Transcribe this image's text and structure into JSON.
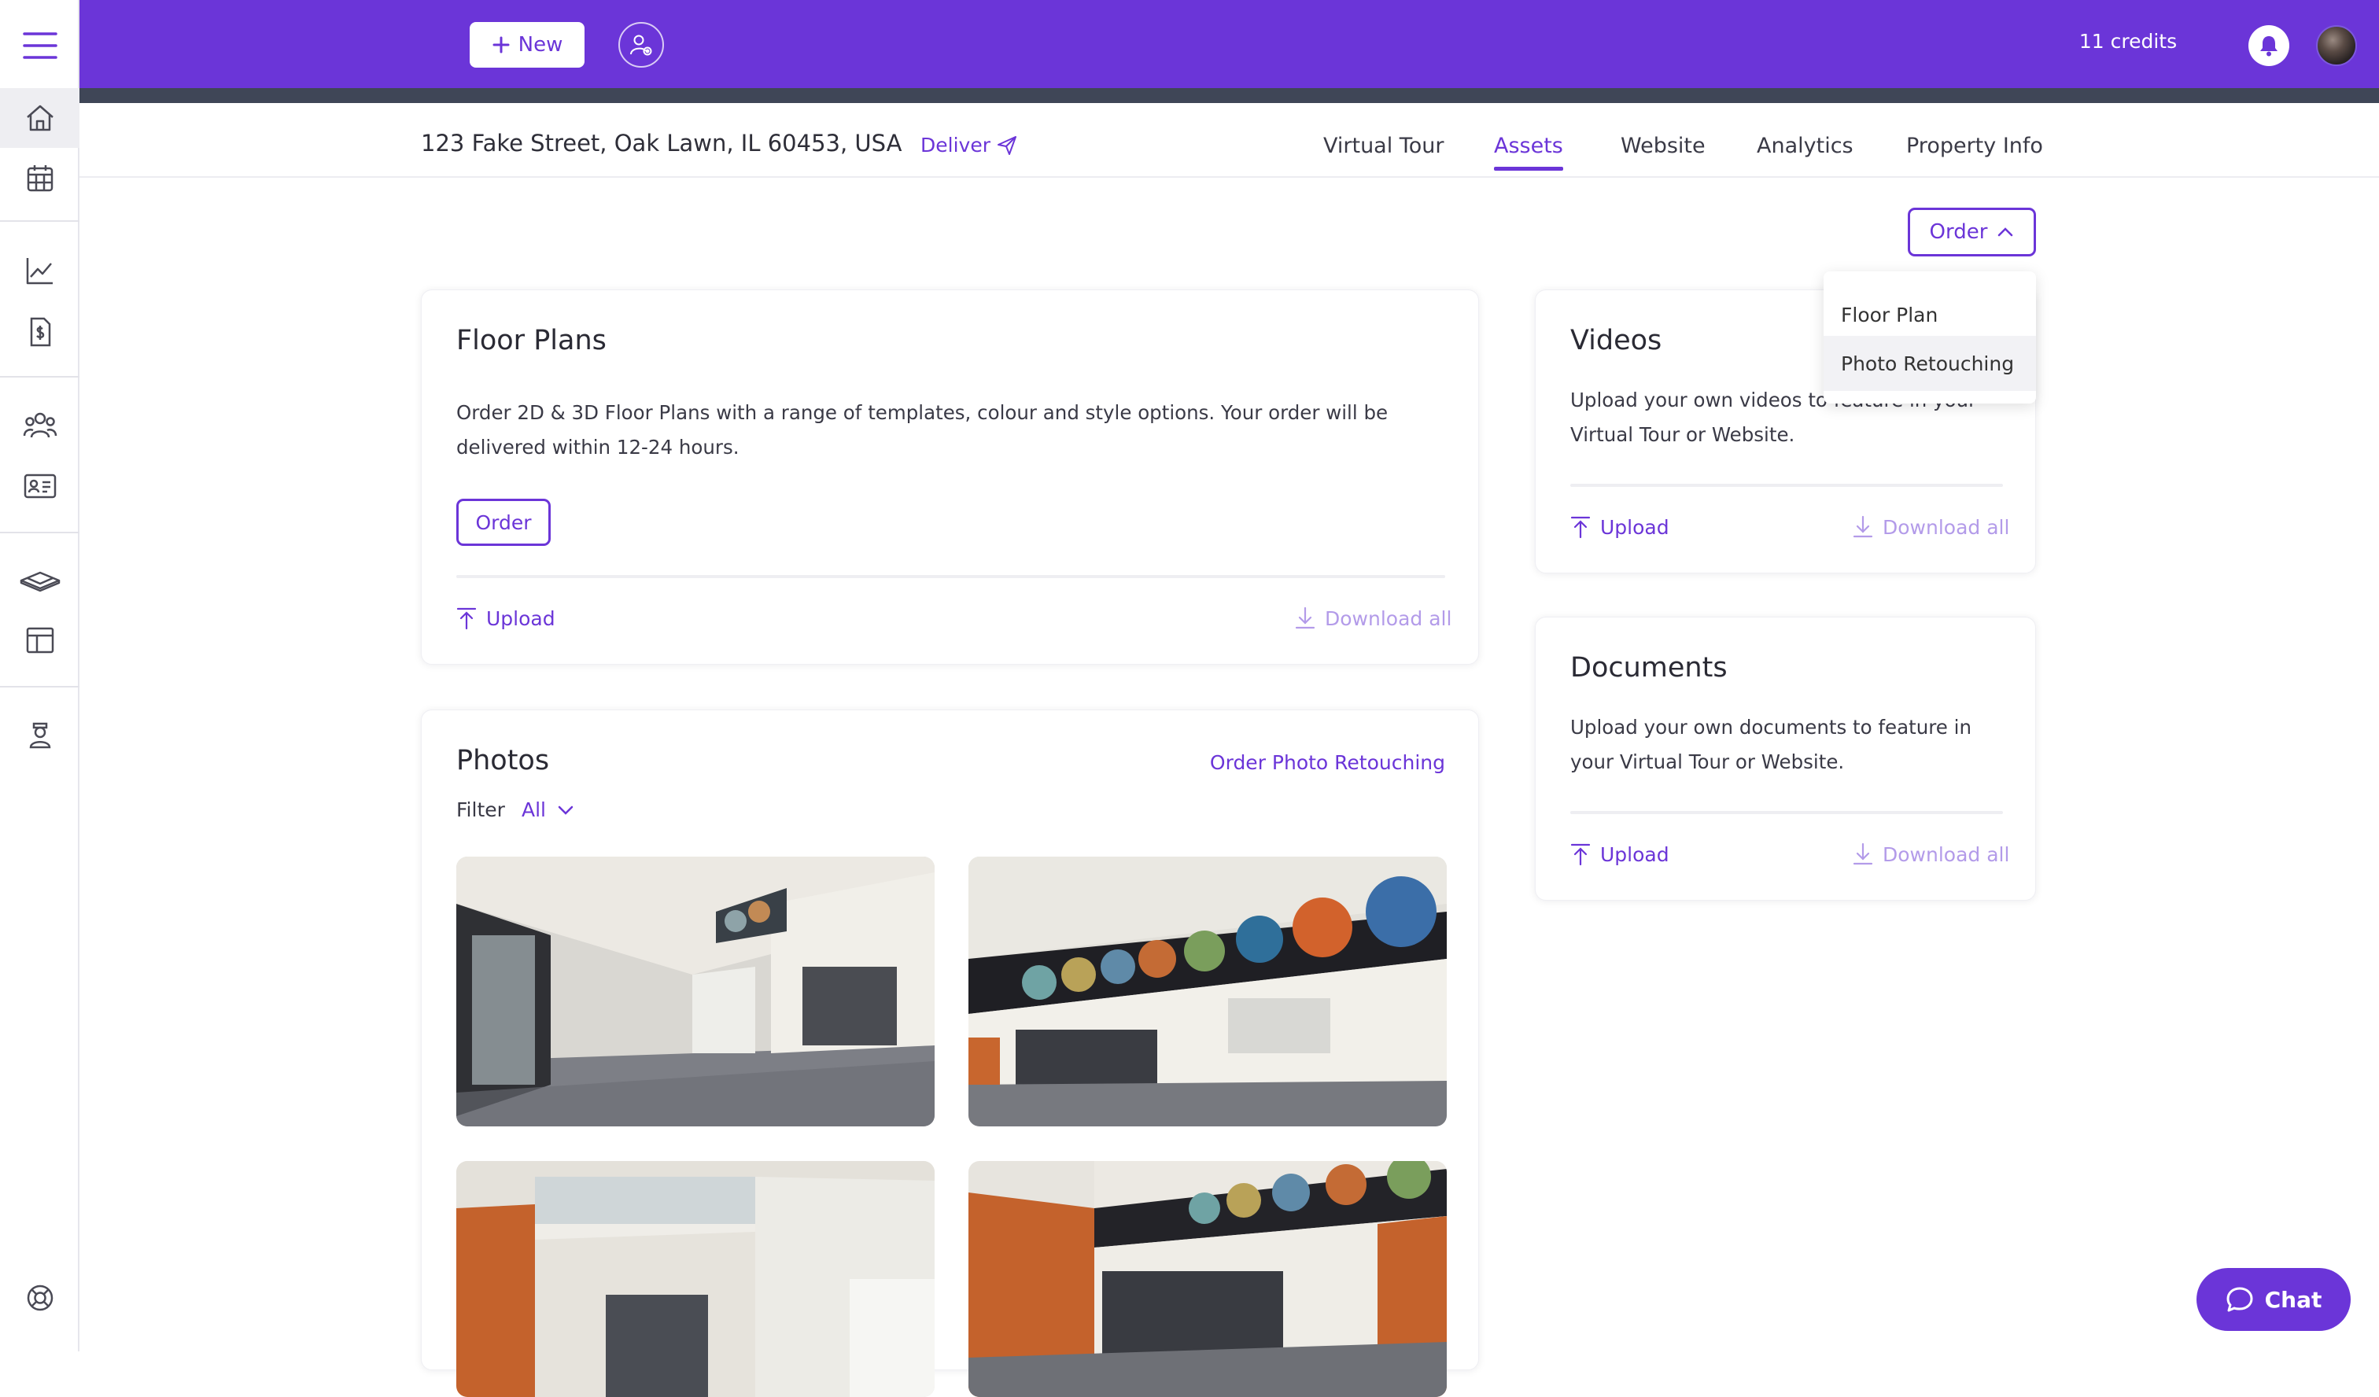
{
  "topbar": {
    "new_label": "New",
    "credits": "11 credits"
  },
  "property": {
    "address": "123 Fake Street, Oak Lawn, IL 60453, USA",
    "deliver_label": "Deliver"
  },
  "tabs": [
    {
      "label": "Virtual Tour",
      "active": false
    },
    {
      "label": "Assets",
      "active": true
    },
    {
      "label": "Website",
      "active": false
    },
    {
      "label": "Analytics",
      "active": false
    },
    {
      "label": "Property Info",
      "active": false
    }
  ],
  "order_menu": {
    "button_label": "Order",
    "items": [
      "Floor Plan",
      "Photo Retouching"
    ]
  },
  "floor_plans": {
    "title": "Floor Plans",
    "description": "Order 2D & 3D Floor Plans with a range of templates, colour and style options. Your order will be delivered within 12-24 hours.",
    "order_label": "Order",
    "upload_label": "Upload",
    "download_label": "Download all"
  },
  "photos": {
    "title": "Photos",
    "order_retouching_label": "Order Photo Retouching",
    "filter_label": "Filter",
    "filter_value": "All"
  },
  "videos": {
    "title": "Videos",
    "description": "Upload your own videos to feature in your Virtual Tour or Website.",
    "upload_label": "Upload",
    "download_label": "Download all"
  },
  "documents": {
    "title": "Documents",
    "description": "Upload your own documents to feature in your Virtual Tour or Website.",
    "upload_label": "Upload",
    "download_label": "Download all"
  },
  "chat": {
    "label": "Chat"
  },
  "colors": {
    "brand": "#6b35d8",
    "brand_light": "#b39be9",
    "subbar": "#3f4657"
  },
  "icons": [
    "menu-icon",
    "home-icon",
    "calendar-icon",
    "chart-icon",
    "invoice-icon",
    "users-icon",
    "contact-card-icon",
    "layers-icon",
    "layout-icon",
    "agent-icon",
    "help-icon",
    "plus-icon",
    "user-settings-icon",
    "bell-icon",
    "send-icon",
    "chevron-up-icon",
    "chevron-down-icon",
    "upload-icon",
    "download-icon",
    "chat-icon"
  ]
}
